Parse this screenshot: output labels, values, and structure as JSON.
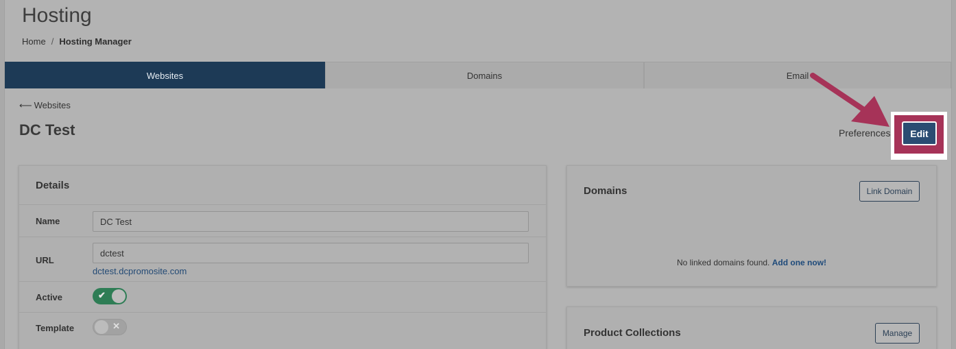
{
  "header": {
    "title": "Hosting",
    "breadcrumb": {
      "home": "Home",
      "separator": "/",
      "current": "Hosting Manager"
    }
  },
  "tabs": [
    {
      "label": "Websites",
      "active": true
    },
    {
      "label": "Domains",
      "active": false
    },
    {
      "label": "Email",
      "active": false
    }
  ],
  "back": {
    "arrow": "⟵",
    "label": "Websites"
  },
  "site": {
    "title": "DC Test"
  },
  "actions": {
    "preferences": "Preferences",
    "edit": "Edit"
  },
  "details": {
    "title": "Details",
    "name": {
      "label": "Name",
      "value": "DC Test"
    },
    "url": {
      "label": "URL",
      "value": "dctest",
      "link": "dctest.dcpromosite.com"
    },
    "active": {
      "label": "Active",
      "on": true,
      "icon": "✔"
    },
    "template": {
      "label": "Template",
      "on": false,
      "icon": "✕"
    }
  },
  "domains_card": {
    "title": "Domains",
    "button": "Link Domain",
    "empty_text": "No linked domains found.",
    "empty_cta": "Add one now!"
  },
  "products_card": {
    "title": "Product Collections",
    "button": "Manage"
  },
  "colors": {
    "primary": "#1d3a56",
    "annotation": "#a63358",
    "toggle_on": "#2e7d55"
  }
}
